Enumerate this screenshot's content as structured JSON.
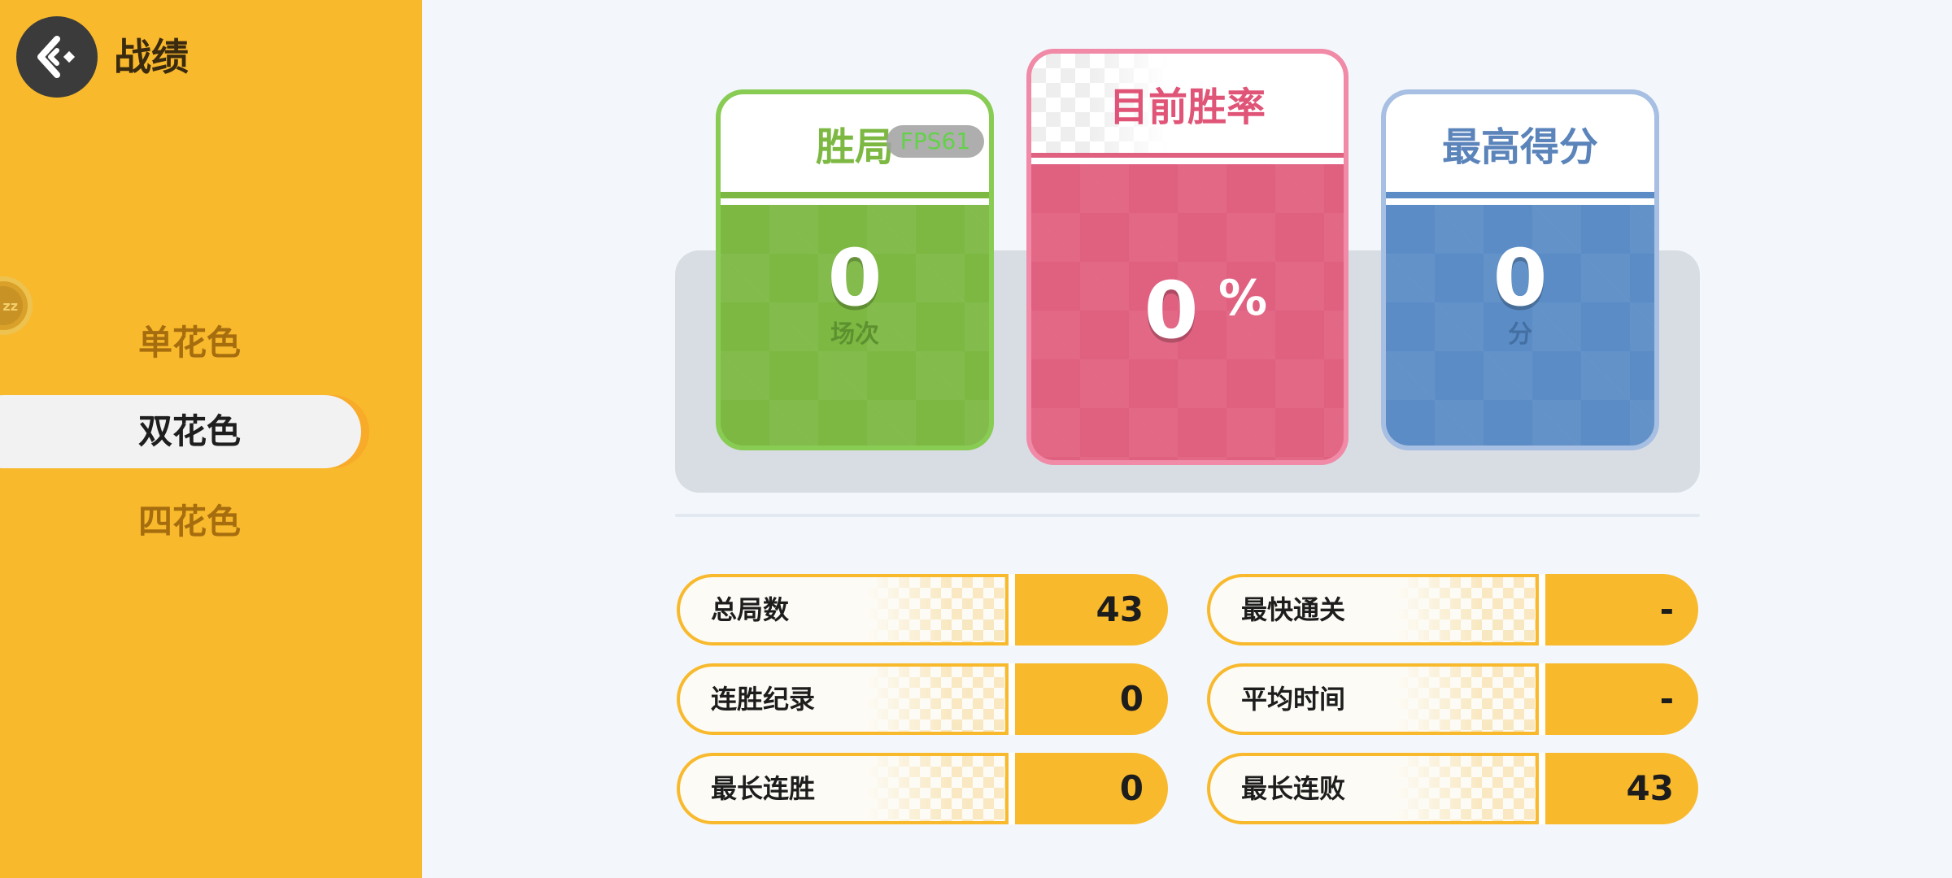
{
  "header": {
    "title": "战绩",
    "back_icon": "back-arrow-icon"
  },
  "sidebar": {
    "avatar_text": "zz",
    "items": [
      {
        "label": "单花色",
        "active": false
      },
      {
        "label": "双花色",
        "active": true
      },
      {
        "label": "四花色",
        "active": false
      }
    ]
  },
  "cards": {
    "wins": {
      "title": "胜局",
      "value": "0",
      "unit": "场次",
      "color": "#7cb842"
    },
    "rate": {
      "title": "目前胜率",
      "value": "0",
      "unit": "%",
      "color": "#e06080"
    },
    "score": {
      "title": "最高得分",
      "value": "0",
      "unit": "分",
      "color": "#5b8cc6"
    }
  },
  "overlay": {
    "fps": "FPS61"
  },
  "stats": {
    "left": [
      {
        "label": "总局数",
        "value": "43"
      },
      {
        "label": "连胜纪录",
        "value": "0"
      },
      {
        "label": "最长连胜",
        "value": "0"
      }
    ],
    "right": [
      {
        "label": "最快通关",
        "value": "-"
      },
      {
        "label": "平均时间",
        "value": "-"
      },
      {
        "label": "最长连败",
        "value": "43"
      }
    ]
  }
}
